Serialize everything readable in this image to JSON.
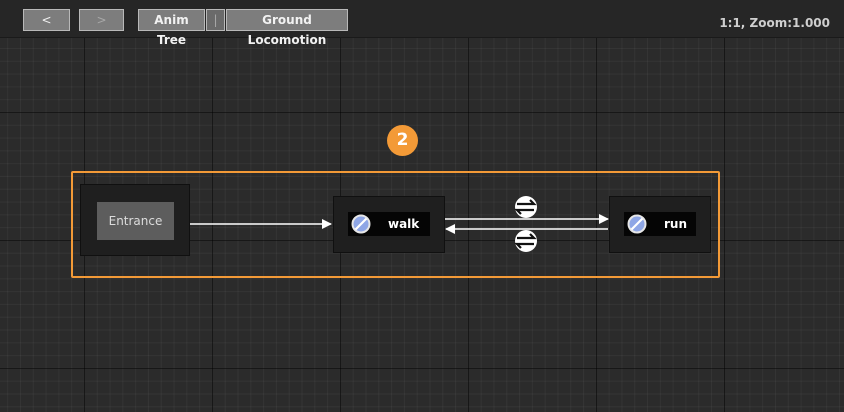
{
  "toolbar": {
    "back_label": "<",
    "forward_label": ">",
    "breadcrumb": [
      "Anim Tree",
      "Ground Locomotion"
    ],
    "separator": "|",
    "zoom_text": "1:1, Zoom:1.000"
  },
  "graph": {
    "entrance_label": "Entrance",
    "states": [
      {
        "label": "walk",
        "icon": "disabled-icon"
      },
      {
        "label": "run",
        "icon": "disabled-icon"
      }
    ],
    "transition_icon": "transition-swap-icon",
    "callout_number": "2"
  },
  "colors": {
    "selection_frame": "#f39a37",
    "callout": "#f39a37",
    "canvas": "#2b2b2b"
  }
}
